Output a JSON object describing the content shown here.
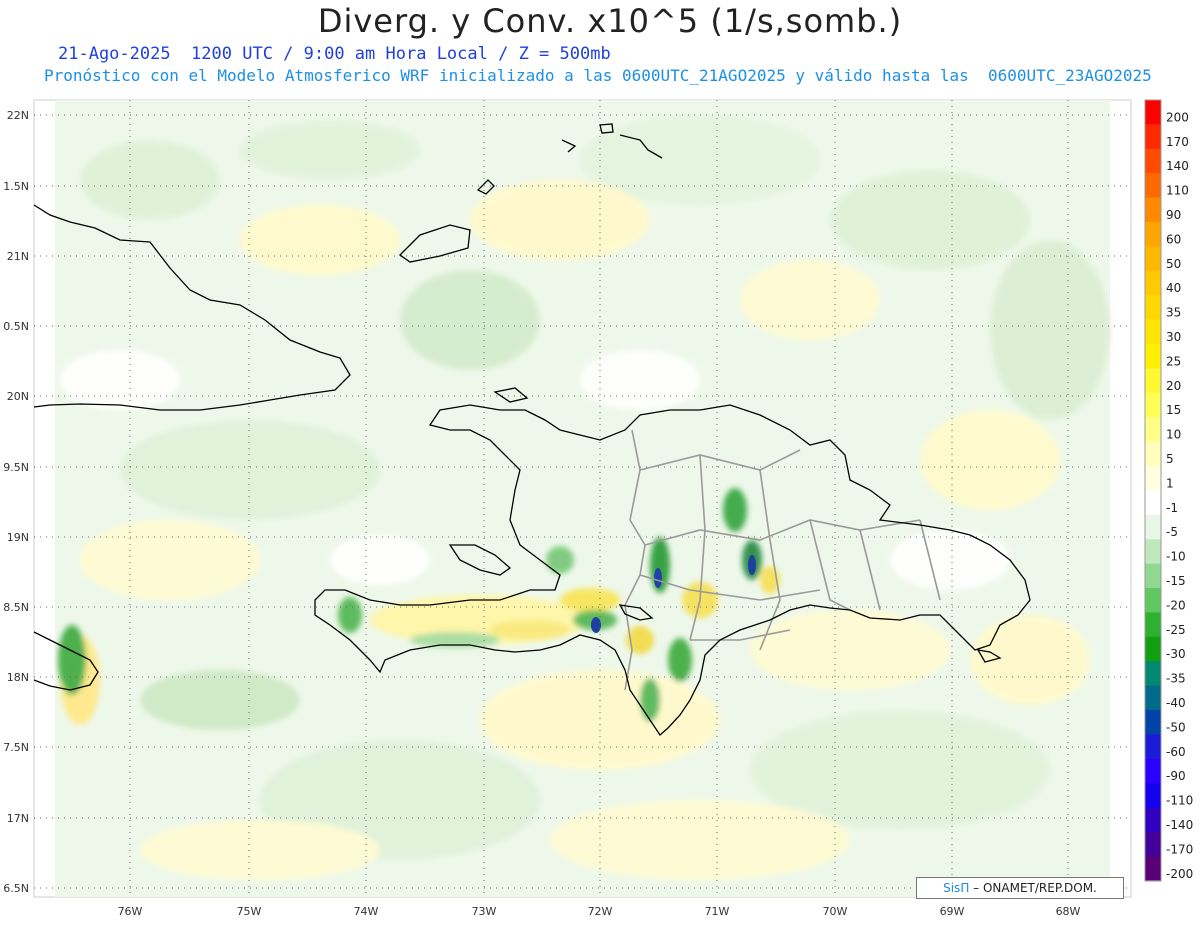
{
  "header": {
    "title": "Diverg. y Conv. x10^5 (1/s,somb.)",
    "subtitle_1": "21-Ago-2025  1200 UTC / 9:00 am Hora Local / Z = 500mb",
    "subtitle_2": "Pronóstico con el Modelo Atmosferico WRF inicializado a las 0600UTC_21AGO2025 y válido hasta las  0600UTC_23AGO2025"
  },
  "axes": {
    "lat_labels": [
      "22N",
      "1.5N",
      "21N",
      "0.5N",
      "20N",
      "9.5N",
      "19N",
      "8.5N",
      "18N",
      "7.5N",
      "17N",
      "6.5N"
    ],
    "lon_labels": [
      "76W",
      "75W",
      "74W",
      "73W",
      "72W",
      "71W",
      "70W",
      "69W",
      "68W"
    ]
  },
  "colorbar": {
    "labels": [
      "200",
      "170",
      "140",
      "110",
      "90",
      "60",
      "50",
      "40",
      "35",
      "30",
      "25",
      "20",
      "15",
      "10",
      "5",
      "1",
      "-1",
      "-5",
      "-10",
      "-15",
      "-20",
      "-25",
      "-30",
      "-35",
      "-40",
      "-50",
      "-60",
      "-90",
      "-110",
      "-140",
      "-170",
      "-200"
    ],
    "colors": [
      "#ff0000",
      "#ff2a00",
      "#ff4a00",
      "#ff6a00",
      "#ff8a00",
      "#ffa500",
      "#ffb800",
      "#ffcb00",
      "#ffd800",
      "#ffe600",
      "#fff000",
      "#fff833",
      "#ffff55",
      "#ffff88",
      "#ffffbb",
      "#ffffe0",
      "#ffffff",
      "#e8f6e8",
      "#bfe8bf",
      "#90d890",
      "#60c860",
      "#30b030",
      "#10a010",
      "#008870",
      "#006a8a",
      "#0044aa",
      "#1b1bd8",
      "#2a00ff",
      "#1400ee",
      "#3000c0",
      "#44009a",
      "#5a0078"
    ]
  },
  "map": {
    "cuba_color": "#000000",
    "border_color": "#999999",
    "background": "#ffffff"
  },
  "credit": {
    "logo": "SisΠ",
    "text": " – ONAMET/REP.DOM."
  }
}
